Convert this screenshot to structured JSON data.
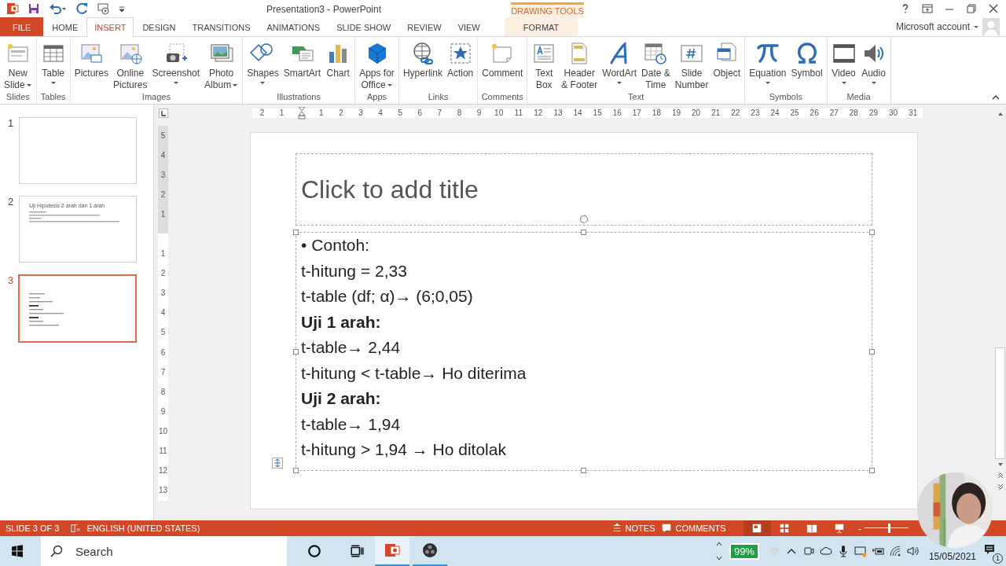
{
  "window": {
    "title": "Presentation3 - PowerPoint",
    "contextual_group": "DRAWING TOOLS",
    "account": "Microsoft account"
  },
  "tabs": [
    {
      "label": "FILE",
      "kind": "file",
      "selected": false
    },
    {
      "label": "HOME",
      "kind": "tab",
      "selected": false
    },
    {
      "label": "INSERT",
      "kind": "tab",
      "selected": true
    },
    {
      "label": "DESIGN",
      "kind": "tab",
      "selected": false
    },
    {
      "label": "TRANSITIONS",
      "kind": "tab",
      "selected": false
    },
    {
      "label": "ANIMATIONS",
      "kind": "tab",
      "selected": false
    },
    {
      "label": "SLIDE SHOW",
      "kind": "tab",
      "selected": false
    },
    {
      "label": "REVIEW",
      "kind": "tab",
      "selected": false
    },
    {
      "label": "VIEW",
      "kind": "tab",
      "selected": false
    },
    {
      "label": "FORMAT",
      "kind": "contextual",
      "selected": false
    }
  ],
  "ribbon": {
    "groups": [
      {
        "name": "Slides",
        "buttons": [
          {
            "label": "New\nSlide",
            "kind": "menu"
          }
        ]
      },
      {
        "name": "Tables",
        "buttons": [
          {
            "label": "Table",
            "kind": "menu_stacked"
          }
        ]
      },
      {
        "name": "Images",
        "buttons": [
          {
            "label": "Pictures",
            "kind": "button"
          },
          {
            "label": "Online\nPictures",
            "kind": "button"
          },
          {
            "label": "Screenshot",
            "kind": "menu_stacked"
          },
          {
            "label": "Photo\nAlbum",
            "kind": "menu"
          }
        ]
      },
      {
        "name": "Illustrations",
        "buttons": [
          {
            "label": "Shapes",
            "kind": "menu_stacked"
          },
          {
            "label": "SmartArt",
            "kind": "button"
          },
          {
            "label": "Chart",
            "kind": "button"
          }
        ]
      },
      {
        "name": "Apps",
        "buttons": [
          {
            "label": "Apps for\nOffice",
            "kind": "menu"
          }
        ]
      },
      {
        "name": "Links",
        "buttons": [
          {
            "label": "Hyperlink",
            "kind": "button"
          },
          {
            "label": "Action",
            "kind": "button"
          }
        ]
      },
      {
        "name": "Comments",
        "buttons": [
          {
            "label": "Comment",
            "kind": "button"
          }
        ]
      },
      {
        "name": "Text",
        "buttons": [
          {
            "label": "Text\nBox",
            "kind": "button"
          },
          {
            "label": "Header\n& Footer",
            "kind": "button"
          },
          {
            "label": "WordArt",
            "kind": "menu_stacked"
          },
          {
            "label": "Date &\nTime",
            "kind": "button"
          },
          {
            "label": "Slide\nNumber",
            "kind": "button"
          },
          {
            "label": "Object",
            "kind": "button"
          }
        ]
      },
      {
        "name": "Symbols",
        "buttons": [
          {
            "label": "Equation",
            "kind": "menu_stacked"
          },
          {
            "label": "Symbol",
            "kind": "button"
          }
        ]
      },
      {
        "name": "Media",
        "buttons": [
          {
            "label": "Video",
            "kind": "menu_stacked"
          },
          {
            "label": "Audio",
            "kind": "menu_stacked"
          }
        ]
      }
    ]
  },
  "slides_pane": {
    "slides": [
      {
        "number": "1",
        "kind": "blank",
        "selected": false
      },
      {
        "number": "2",
        "kind": "title_and_text",
        "title": "Uji Hipotesis 2 arah dan 1 arah",
        "selected": false
      },
      {
        "number": "3",
        "kind": "text",
        "selected": true
      }
    ]
  },
  "rulers": {
    "horizontal": [
      "2",
      "1",
      "1",
      "2",
      "3",
      "4",
      "5",
      "6",
      "7",
      "8",
      "9",
      "10",
      "11",
      "12",
      "13",
      "14",
      "15",
      "16",
      "17",
      "18",
      "19",
      "20",
      "21",
      "22",
      "23",
      "24",
      "25",
      "26",
      "27",
      "28",
      "29",
      "30",
      "31"
    ],
    "vertical": [
      "5",
      "4",
      "3",
      "2",
      "1",
      "1",
      "2",
      "3",
      "4",
      "5",
      "6",
      "7",
      "8",
      "9",
      "10",
      "11",
      "12",
      "13"
    ]
  },
  "slide": {
    "title_placeholder": "Click to add title",
    "body": [
      {
        "kind": "bullet",
        "bullet": "•",
        "text": "Contoh:"
      },
      {
        "kind": "plain",
        "text": "t-hitung = 2,33"
      },
      {
        "kind": "plain",
        "text": "t-table (df; α)→ (6;0,05)"
      },
      {
        "kind": "heading",
        "text": "Uji 1 arah:"
      },
      {
        "kind": "plain",
        "text": "t-table→ 2,44"
      },
      {
        "kind": "plain",
        "text": "t-hitung < t-table→ Ho diterima"
      },
      {
        "kind": "heading",
        "text": "Uji 2 arah:"
      },
      {
        "kind": "plain",
        "text": "t-table→ 1,94"
      },
      {
        "kind": "plain",
        "text": "t-hitung > 1,94 → Ho ditolak"
      }
    ]
  },
  "status_bar": {
    "slide_info": "SLIDE 3 OF 3",
    "language": "ENGLISH (UNITED STATES)",
    "notes": "NOTES",
    "comments": "COMMENTS",
    "views": [
      {
        "selected": true
      },
      {
        "selected": false
      },
      {
        "selected": false
      },
      {
        "selected": false
      }
    ],
    "zoom_minus": "-",
    "zoom": {
      "level": 0.55
    }
  },
  "taskbar": {
    "search": {
      "placeholder": "Search"
    },
    "apps": [
      {
        "selected": true
      },
      {
        "selected": false
      }
    ],
    "battery": "99%",
    "date": "15/05/2021",
    "notifications": "1"
  }
}
